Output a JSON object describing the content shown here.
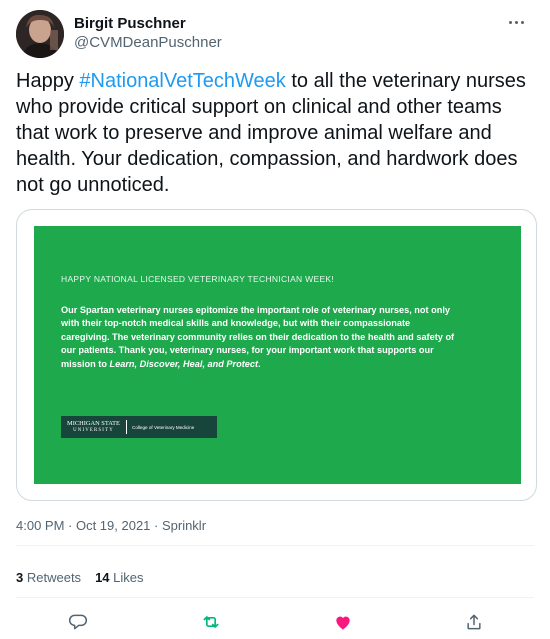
{
  "author": {
    "display_name": "Birgit Puschner",
    "handle": "@CVMDeanPuschner"
  },
  "tweet": {
    "text_before": "Happy ",
    "hashtag": "#NationalVetTechWeek",
    "text_after": " to all the veterinary nurses who provide critical support on clinical and other teams that work to preserve and improve animal welfare and health. Your dedication, compassion,  and hardwork does not go unnoticed."
  },
  "media": {
    "heading": "HAPPY NATIONAL LICENSED VETERINARY TECHNICIAN WEEK!",
    "body_text": "Our Spartan veterinary nurses epitomize the important role of veterinary nurses, not only with their top-notch medical skills and knowledge, but with their compassionate caregiving. The veterinary community relies on their dedication to the health and safety of our patients. Thank you, veterinary nurses, for your important work that supports our mission to ",
    "body_emphasis": "Learn, Discover, Heal, and Protect",
    "body_end": ".",
    "logo_line1": "MICHIGAN STATE",
    "logo_line2": "UNIVERSITY",
    "logo_college": "College of Veterinary Medicine",
    "background_color": "#1ea94d"
  },
  "meta": {
    "timestamp": "4:00 PM · Oct 19, 2021 · Sprinklr"
  },
  "stats": {
    "retweets_count": "3",
    "retweets_label": "Retweets",
    "likes_count": "14",
    "likes_label": "Likes"
  },
  "actions": {
    "reply_icon": "reply-icon",
    "retweet_icon": "retweet-icon",
    "like_icon": "heart-icon",
    "share_icon": "share-icon",
    "retweet_color": "#00ba7c",
    "like_color": "#f91880"
  },
  "colors": {
    "link": "#1d9bf0",
    "secondary_text": "#536471"
  }
}
